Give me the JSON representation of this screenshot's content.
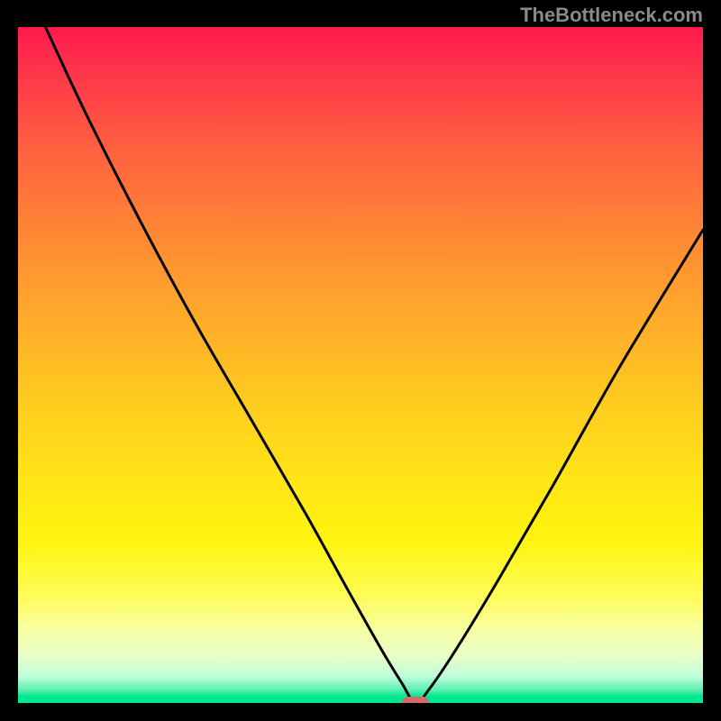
{
  "watermark": "TheBottleneck.com",
  "chart_data": {
    "type": "line",
    "title": "",
    "xlabel": "",
    "ylabel": "",
    "xlim": [
      0,
      100
    ],
    "ylim": [
      0,
      100
    ],
    "grid": false,
    "legend": false,
    "description": "Bottleneck percentage curve with V-shaped minimum; vertical gradient background red (top, high bottleneck) to green (bottom, zero bottleneck)",
    "series": [
      {
        "name": "bottleneck-curve",
        "x": [
          4,
          10,
          18,
          26,
          34,
          42,
          48,
          53,
          56,
          58,
          60,
          64,
          70,
          78,
          88,
          100
        ],
        "values": [
          100,
          87,
          71,
          56,
          42,
          28,
          17,
          8,
          3,
          0,
          2,
          8,
          18,
          32,
          50,
          70
        ]
      }
    ],
    "marker": {
      "name": "optimum-marker",
      "x": 58,
      "y": 0,
      "width_pct": 4,
      "color": "#d46a6a"
    },
    "gradient_stops": [
      {
        "pct": 0,
        "color": "#ff1a4d"
      },
      {
        "pct": 50,
        "color": "#ffc020"
      },
      {
        "pct": 80,
        "color": "#fff80a"
      },
      {
        "pct": 100,
        "color": "#00e890"
      }
    ]
  }
}
